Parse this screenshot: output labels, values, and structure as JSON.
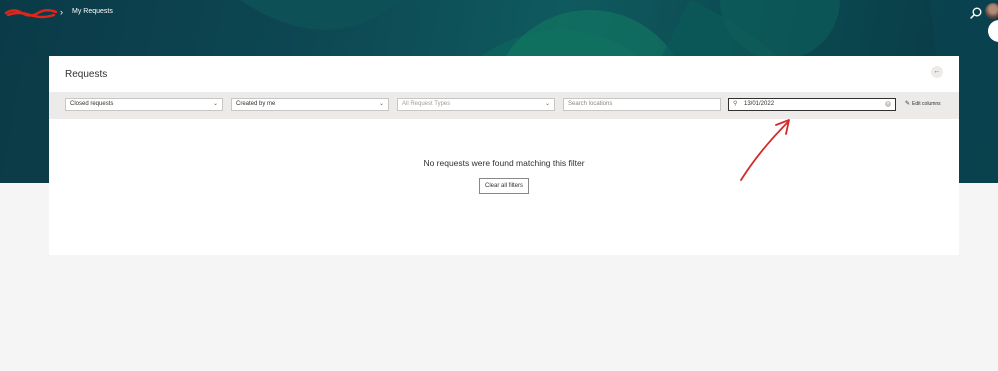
{
  "header": {
    "breadcrumb_current": "My Requests",
    "breadcrumb_separator": "›"
  },
  "page": {
    "title": "Requests",
    "back_icon": "arrow-left-icon"
  },
  "filters": {
    "status": {
      "value": "Closed requests"
    },
    "creator": {
      "value": "Created by me"
    },
    "request_type": {
      "placeholder": "All Request Types"
    },
    "location": {
      "placeholder": "Search locations"
    },
    "date_search": {
      "value": "13/01/2022"
    },
    "edit_columns_label": "Edit columns"
  },
  "empty_state": {
    "message": "No requests were found matching this filter",
    "clear_button": "Clear all filters"
  },
  "colors": {
    "header_bg": "#0d4752",
    "accent_green": "#0f7a61",
    "annotation_red": "#d42a2a"
  }
}
